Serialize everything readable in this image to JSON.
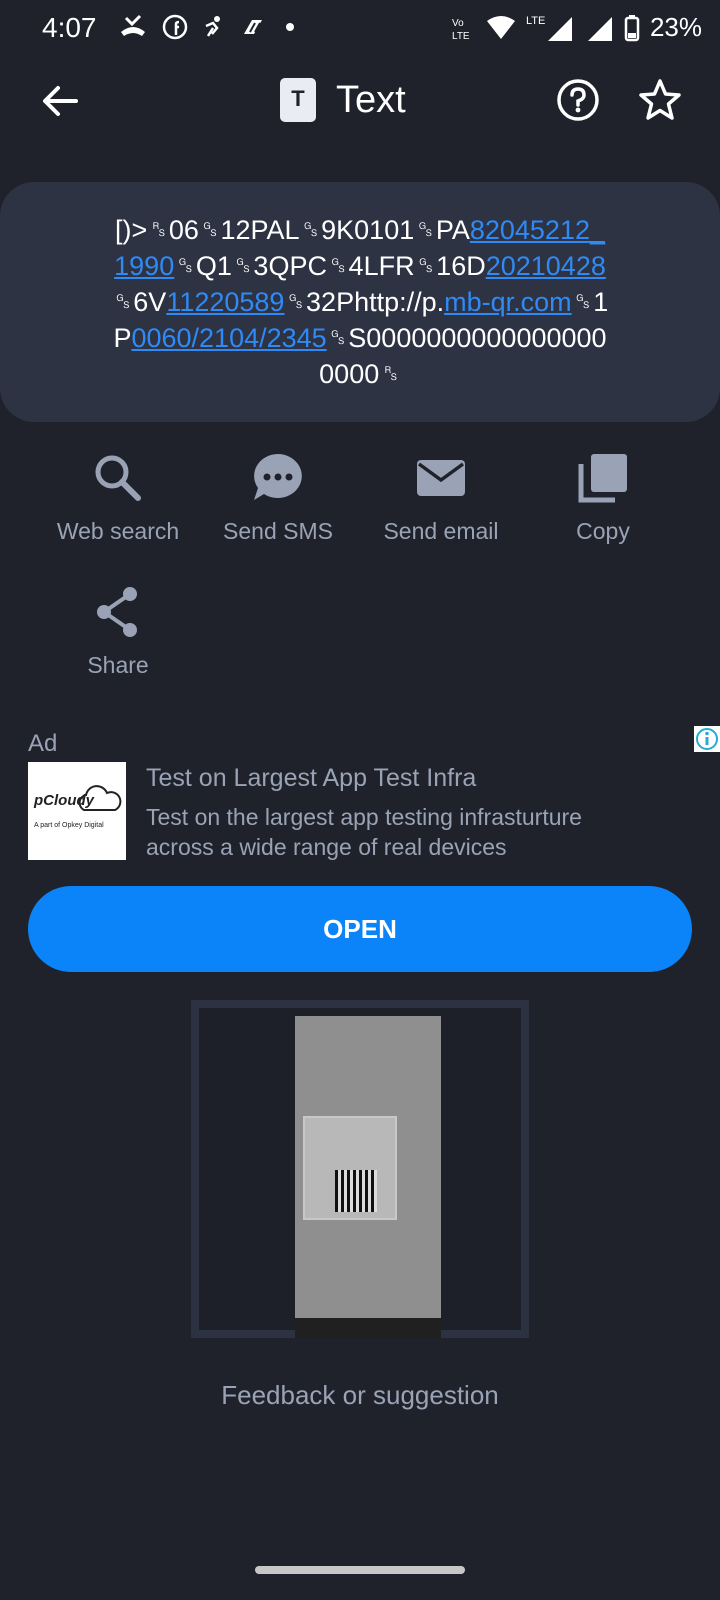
{
  "status_bar": {
    "time": "4:07",
    "battery": "23%",
    "network": "LTE",
    "volte": "Vo LTE"
  },
  "header": {
    "title": "Text",
    "icon_letter": "T"
  },
  "content": {
    "segments": [
      {
        "text": "[)>␞06␝12PAL␝9K0101␝PA",
        "link": false
      },
      {
        "text": "82045212_1990",
        "link": true
      },
      {
        "text": "␝Q1␝3QPC␝4LFR␝16D",
        "link": false
      },
      {
        "text": "20210428",
        "link": true
      },
      {
        "text": "␝6V",
        "link": false
      },
      {
        "text": "11220589",
        "link": true
      },
      {
        "text": "␝32Phttp://p.",
        "link": false
      },
      {
        "text": "mb-qr.com",
        "link": true
      },
      {
        "text": "␝1P",
        "link": false
      },
      {
        "text": "0060/2104/2345",
        "link": true
      },
      {
        "text": "␝S00000000000000000000␞",
        "link": false
      }
    ]
  },
  "actions": [
    {
      "label": "Web search",
      "icon": "search-icon"
    },
    {
      "label": "Send SMS",
      "icon": "sms-icon"
    },
    {
      "label": "Send email",
      "icon": "email-icon"
    },
    {
      "label": "Copy",
      "icon": "copy-icon"
    },
    {
      "label": "Share",
      "icon": "share-icon"
    }
  ],
  "ad": {
    "label": "Ad",
    "logo_brand": "pCloudy",
    "logo_sub": "A part of Opkey Digital",
    "title": "Test on Largest App Test Infra",
    "description": "Test on the largest app testing infrasturture across a wide range of real devices",
    "cta": "OPEN"
  },
  "footer": {
    "feedback": "Feedback or suggestion"
  },
  "colors": {
    "background": "#1f222b",
    "card": "#2e3343",
    "accent": "#0a84f8",
    "link": "#2f8af5",
    "muted_text": "#9aa3b5"
  }
}
